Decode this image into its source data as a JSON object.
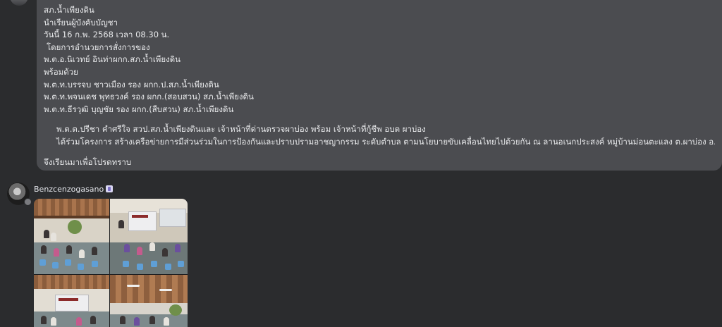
{
  "message": {
    "lines": [
      "สภ.น้ำเพียงดิน",
      "นำเรียนผู้บังคับบัญชา",
      "วันนี้ 16 ก.พ. 2568 เวลา 08.30 น.",
      "โดยการอำนวยการสั่งการของ",
      "พ.ต.อ.นิเวทย์ อินท่าผกก.สภ.น้ำเพียงดิน",
      "พร้อมด้วย",
      "พ.ต.ท.บรรจบ ชาวเมือง รอง ผกก.ป.สภ.น้ำเพียงดิน",
      "พ.ต.ท.พจนเดช พุทธวงค์ รอง ผกก.(สอบสวน) สภ.น้ำเพียงดิน",
      "พ.ต.ท.ธีรวุฒิ บุญชัย รอง ผกก.(สืบสวน) สภ.น้ำเพียงดิน",
      "พ.ต.ต.ปรีชา คำศรีใจ สวป.สภ.น้ำเพียงดินและ เจ้าหน้าที่ด่านตรวจผาบ่อง พร้อม เจ้าหน้าที่กู้ชีพ อบต ผาบ่อง",
      "ได้ร่วมโครงการ สร้างเครือข่ายการมีส่วนร่วมในการป้องกันและปราบปรามอาชญากรรม ระดับตำบล ตามนโยบายขับเคลื่อนไทยไปด้วยกัน ณ ลานอเนกประสงค์ หมู่บ้านม่อนตะแลง ต.ผาบ่อง อ.เมือง จ.แม่ฮ่องสอน",
      "จึงเรียนมาเพื่อโปรดทราบ"
    ]
  },
  "post": {
    "author_name": "Benzcenzogasano",
    "photo_count": 4
  },
  "colors": {
    "background": "#2b2c2e",
    "bubble": "#4b4c50",
    "text": "#e9eaec"
  }
}
